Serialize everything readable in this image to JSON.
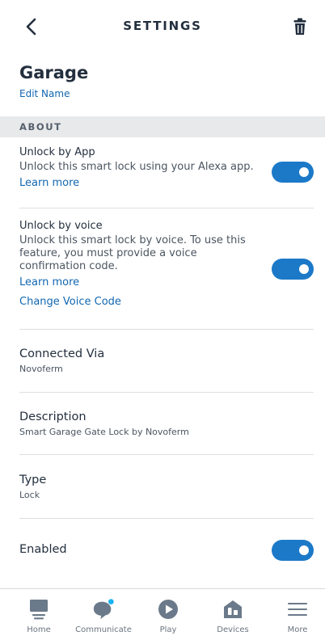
{
  "header": {
    "title": "SETTINGS",
    "back_icon": "chevron-left-icon",
    "delete_icon": "trash-icon"
  },
  "device": {
    "name": "Garage",
    "edit_label": "Edit Name"
  },
  "section": {
    "about": "ABOUT"
  },
  "unlock_app": {
    "title": "Unlock by App",
    "description": "Unlock this smart lock using your Alexa app.",
    "link": "Learn more",
    "enabled": true
  },
  "unlock_voice": {
    "title": "Unlock by voice",
    "description": "Unlock this smart lock by voice. To use this feature, you must provide a voice confirmation code.",
    "link": "Learn more",
    "change_code": "Change Voice Code",
    "enabled": true
  },
  "connected": {
    "title": "Connected Via",
    "value": "Novoferm"
  },
  "description": {
    "title": "Description",
    "value": "Smart Garage Gate Lock by Novoferm"
  },
  "type": {
    "title": "Type",
    "value": "Lock"
  },
  "enabled": {
    "title": "Enabled",
    "enabled": true
  },
  "colors": {
    "accent": "#1c79c8",
    "link": "#1167b1",
    "text": "#232f3e",
    "notification_dot": "#19b3f0"
  },
  "tabs": [
    {
      "label": "Home",
      "icon": "home-icon"
    },
    {
      "label": "Communicate",
      "icon": "chat-bubble-icon",
      "has_notification": true
    },
    {
      "label": "Play",
      "icon": "play-icon"
    },
    {
      "label": "Devices",
      "icon": "devices-icon"
    },
    {
      "label": "More",
      "icon": "menu-icon"
    }
  ]
}
